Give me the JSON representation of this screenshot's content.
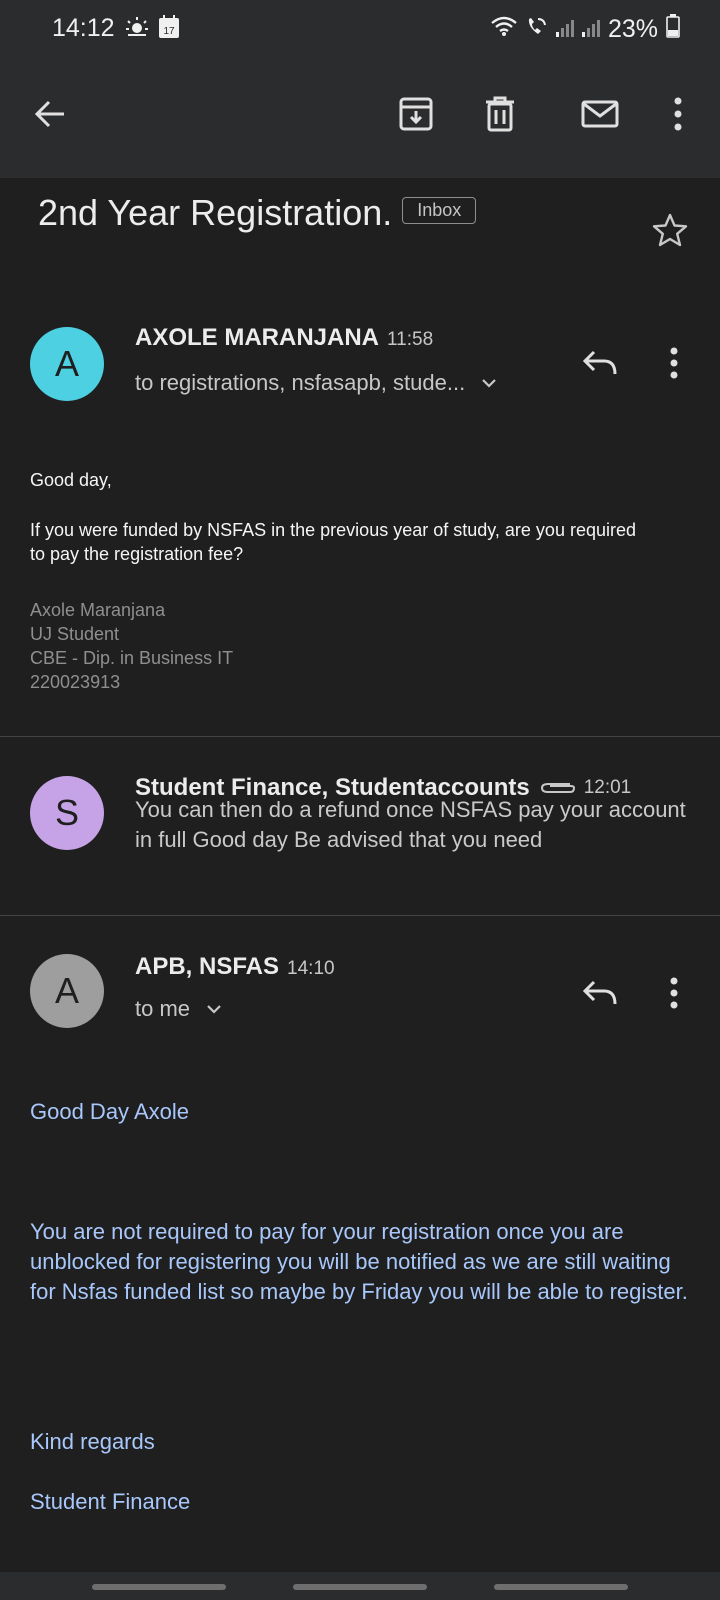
{
  "status_bar": {
    "time": "14:12",
    "calendar_day": "17",
    "battery": "23%"
  },
  "toolbar": {
    "back": "arrow-back-icon",
    "archive": "archive-icon",
    "delete": "delete-icon",
    "mark_unread": "mail-icon",
    "more": "more-vert-icon"
  },
  "subject": {
    "title": "2nd Year Registration.",
    "label": "Inbox"
  },
  "messages": [
    {
      "avatar_letter": "A",
      "avatar_color": "#4dd0e1",
      "sender": "AXOLE MARANJANA",
      "time": "11:58",
      "recipients": "to registrations, nsfasapb, stude...",
      "greeting": "Good day,",
      "body": "If you were funded by NSFAS in the previous year of study, are you required to pay the registration fee?",
      "signature": [
        "Axole Maranjana",
        "UJ Student",
        "CBE - Dip. in Business IT",
        "220023913"
      ]
    },
    {
      "avatar_letter": "S",
      "avatar_color": "#c5a3e6",
      "sender": "Student Finance, Studentaccounts",
      "time": "12:01",
      "preview": "You can then do a refund once NSFAS pay your account in full Good day Be advised that you need"
    },
    {
      "avatar_letter": "A",
      "avatar_color": "#9e9e9e",
      "sender": "APB, NSFAS",
      "time": "14:10",
      "recipients": "to me",
      "greeting": "Good Day Axole",
      "body": "You are not required to pay for your registration once you are unblocked for registering you will be notified as we are still waiting for Nsfas funded list so maybe by Friday you will be able to register.",
      "closing": "Kind regards",
      "signoff": "Student Finance"
    }
  ]
}
